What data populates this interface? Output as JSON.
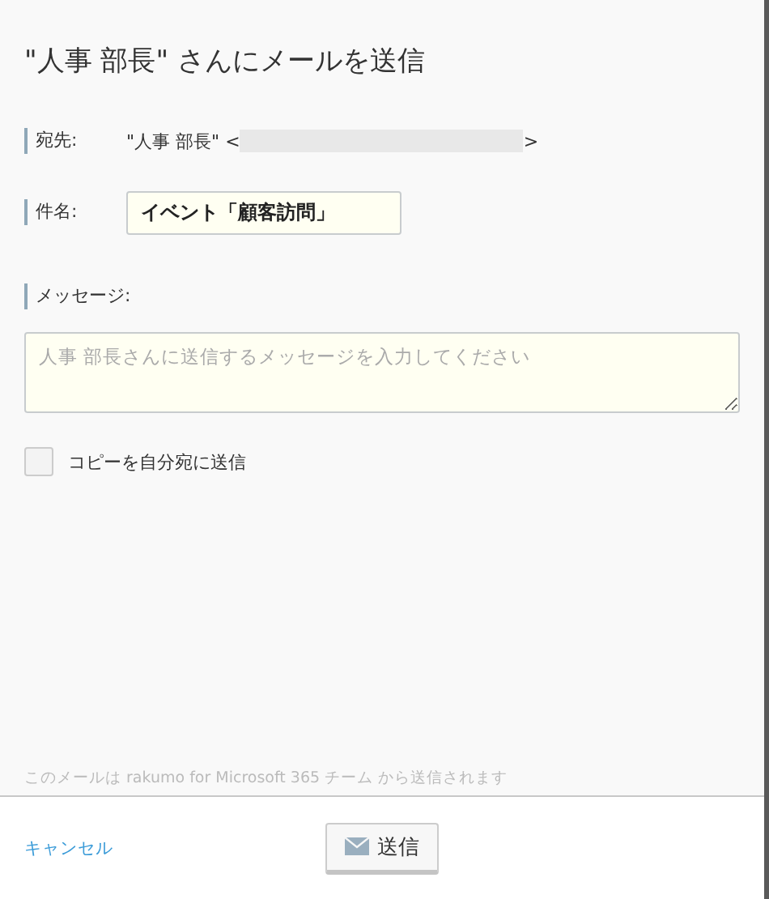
{
  "dialog": {
    "title": "\"人事 部長\" さんにメールを送信"
  },
  "to": {
    "label": "宛先:",
    "name": "\"人事 部長\" <",
    "close": ">"
  },
  "subject": {
    "label": "件名:",
    "value": "イベント「顧客訪問」"
  },
  "message": {
    "label": "メッセージ:",
    "placeholder": "人事 部長さんに送信するメッセージを入力してください"
  },
  "copy_to_self": {
    "label": "コピーを自分宛に送信",
    "checked": false
  },
  "note": "このメールは rakumo for Microsoft 365 チーム から送信されます",
  "footer": {
    "cancel": "キャンセル",
    "send": "送信"
  }
}
